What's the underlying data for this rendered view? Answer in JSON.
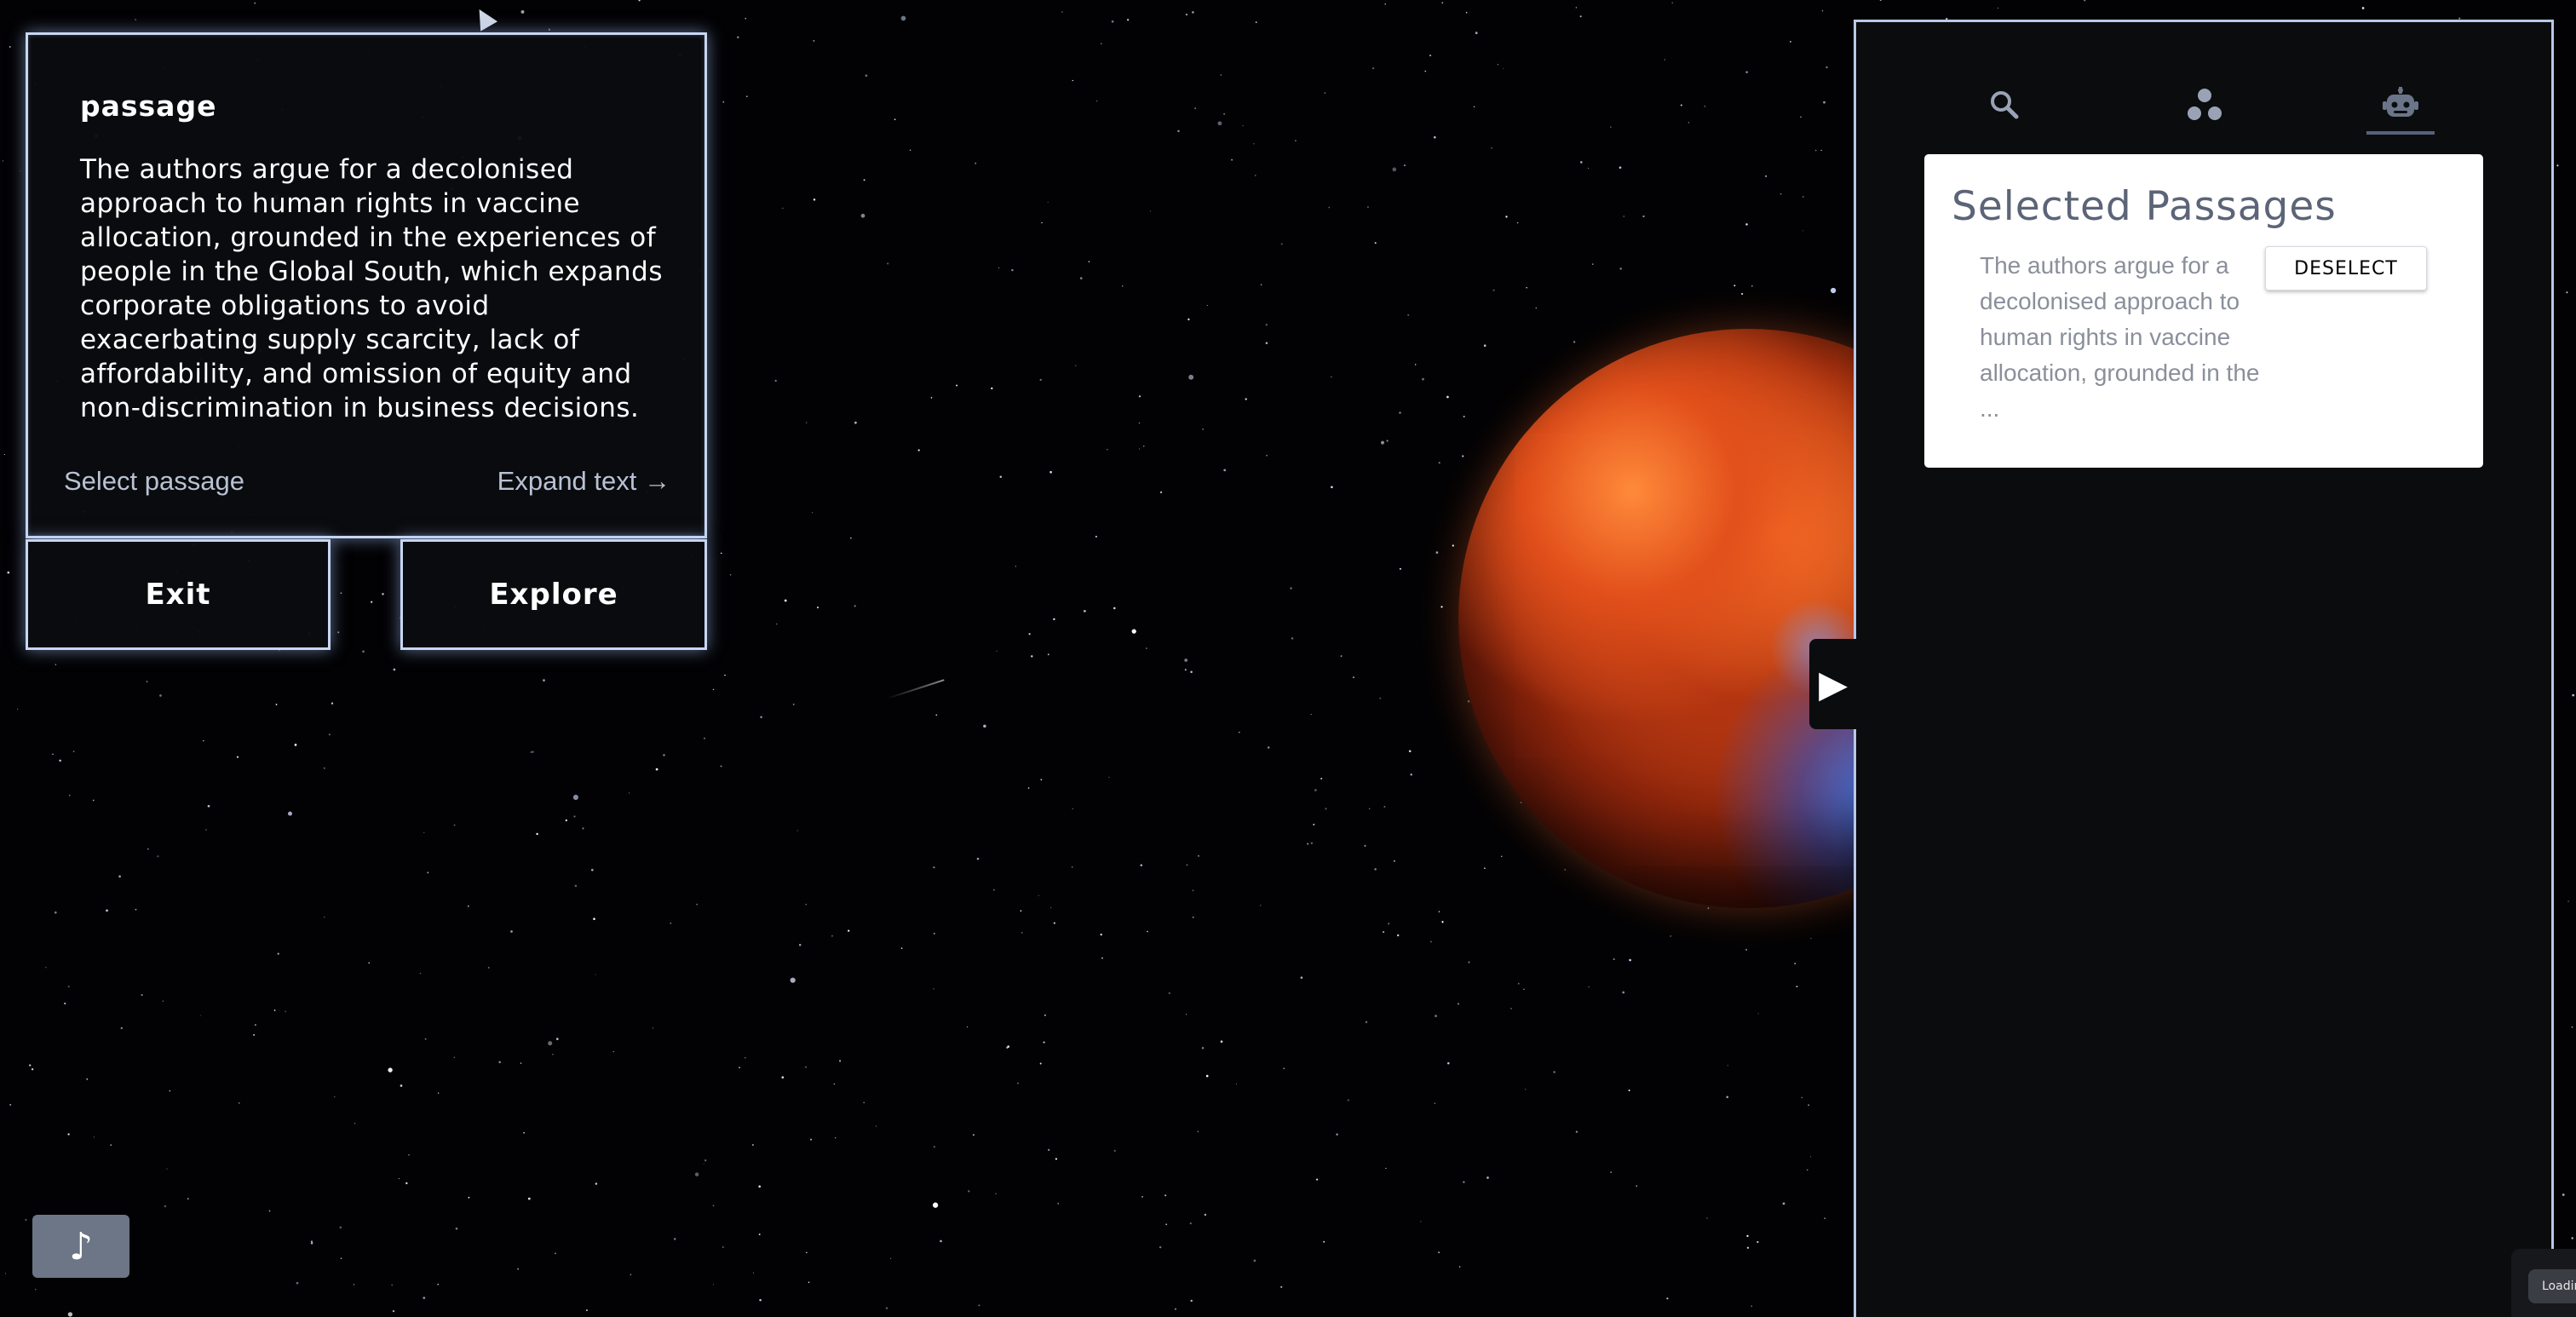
{
  "passage_card": {
    "title": "passage",
    "text": "The authors argue for a decolonised approach to human rights in vaccine allocation, grounded in the experiences of people in the Global South, which expands corporate obligations to avoid exacerbating supply scarcity, lack of affordability, and omission of equity and non-discrimination in business decisions.",
    "select_label": "Select passage",
    "expand_label": "Expand text →"
  },
  "actions": {
    "exit_label": "Exit",
    "explore_label": "Explore"
  },
  "music": {
    "icon": "music-note-icon",
    "glyph": "♪"
  },
  "side_panel": {
    "toggle_glyph": "▶",
    "tabs": [
      {
        "icon": "search-icon",
        "active": false
      },
      {
        "icon": "cluster-icon",
        "active": false
      },
      {
        "icon": "robot-icon",
        "active": true
      }
    ],
    "selected": {
      "title": "Selected Passages",
      "items": [
        {
          "excerpt": "The authors argue for a decolonised approach to human rights in vaccine allocation, grounded in the ...",
          "action_label": "DESELECT"
        }
      ]
    }
  },
  "loading": {
    "text": "Loadin"
  },
  "colors": {
    "panel_border": "#b9c8e6",
    "card_glow": "#c7d6f2",
    "title_gray": "#5c6477",
    "music_button": "#6d7686"
  }
}
